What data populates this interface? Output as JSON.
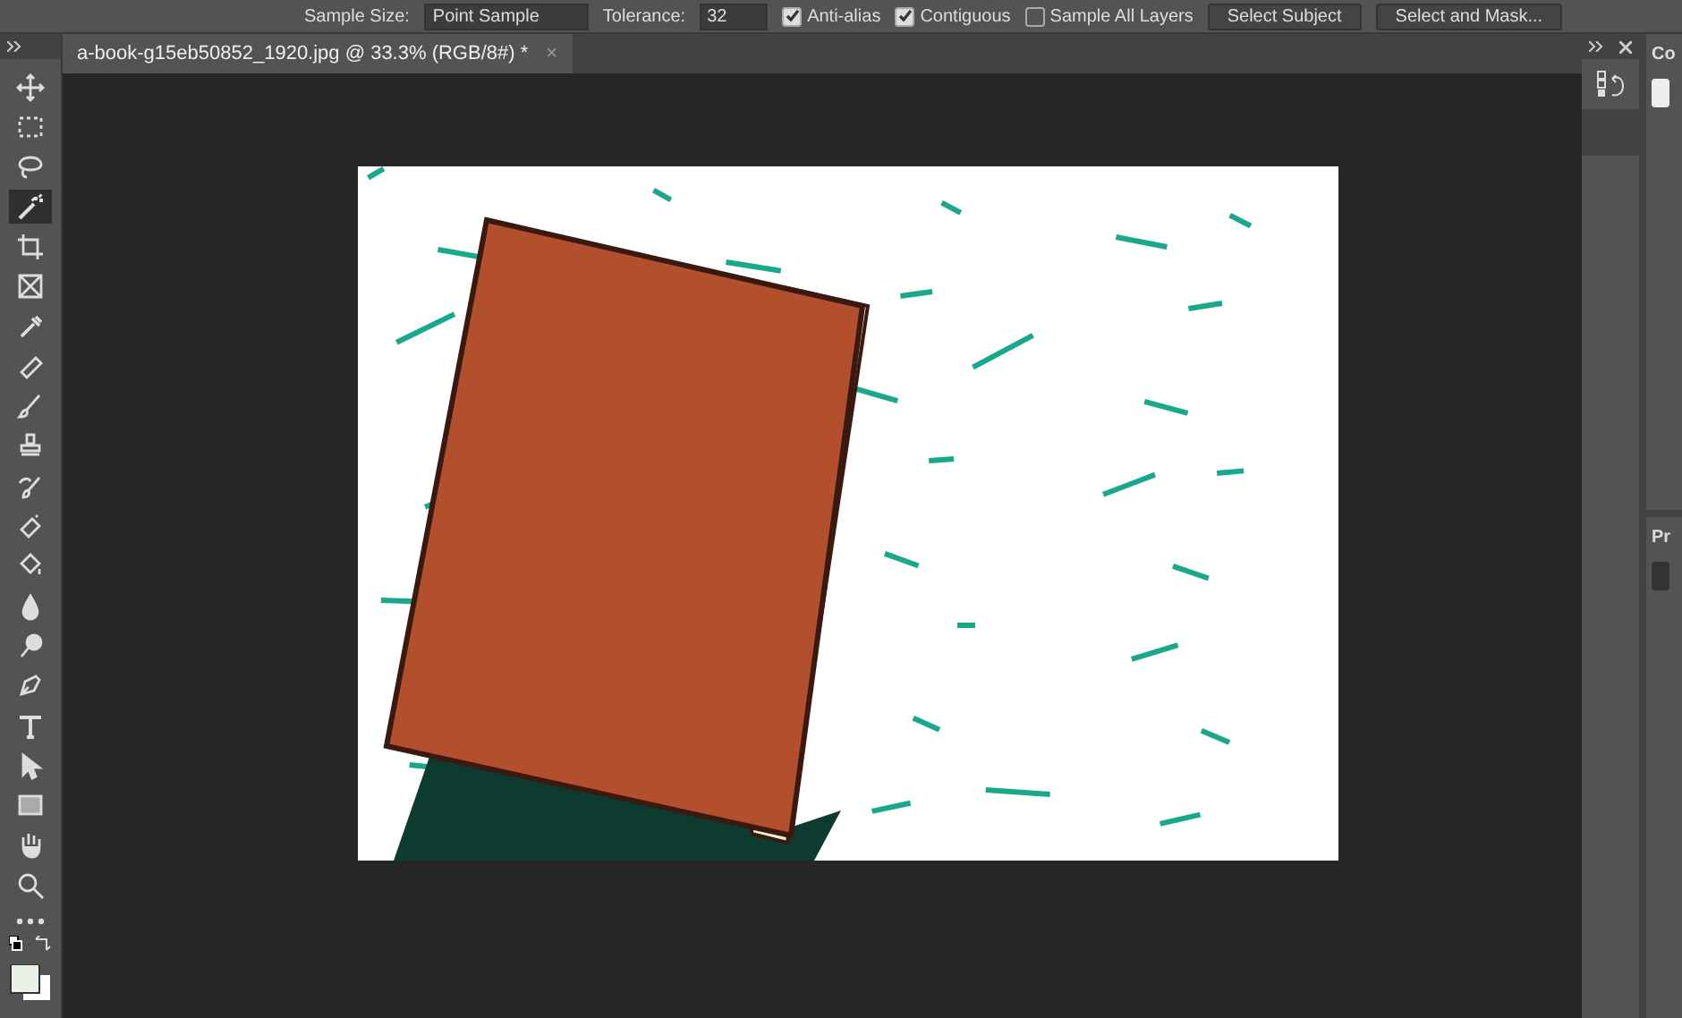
{
  "options_bar": {
    "sample_size_label": "Sample Size:",
    "sample_size": "Point Sample",
    "tolerance_label": "Tolerance:",
    "tolerance": "32",
    "checkboxes": [
      {
        "label": "Anti-alias",
        "checked": true
      },
      {
        "label": "Contiguous",
        "checked": true
      },
      {
        "label": "Sample All Layers",
        "checked": false
      }
    ],
    "buttons": [
      "Select Subject",
      "Select and Mask..."
    ]
  },
  "tabs": [
    {
      "label": "a-book-g15eb50852_1920.jpg @ 33.3% (RGB/8#) *",
      "close": "×",
      "selected": true
    }
  ],
  "tools": [
    {
      "selected": false
    },
    {
      "selected": false
    },
    {
      "selected": false
    },
    {
      "selected": true
    },
    {
      "selected": false
    },
    {
      "selected": false
    },
    {
      "selected": false
    },
    {
      "selected": false
    },
    {
      "selected": false
    },
    {
      "selected": false
    },
    {
      "selected": false
    },
    {
      "selected": false
    },
    {
      "selected": false
    },
    {
      "selected": false
    },
    {
      "selected": false
    },
    {
      "selected": false
    },
    {
      "selected": false
    },
    {
      "selected": false
    },
    {
      "selected": false
    },
    {
      "selected": false
    },
    {
      "selected": false
    }
  ],
  "right_panels": [
    {
      "title": "Co"
    },
    {
      "title": "Pr"
    }
  ]
}
